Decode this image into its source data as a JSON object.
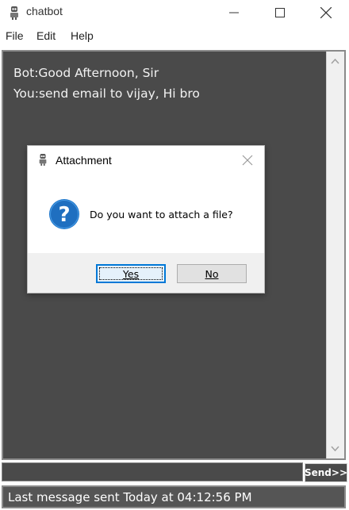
{
  "window": {
    "title": "chatbot",
    "icon": "robot-icon"
  },
  "menu": {
    "items": [
      "File",
      "Edit",
      "Help"
    ]
  },
  "chat": {
    "messages": [
      "Bot:Good Afternoon, Sir",
      "You:send email to vijay, Hi bro"
    ],
    "background": "#4a4a4a"
  },
  "input": {
    "value": "",
    "send_label": "Send>>"
  },
  "status": {
    "text": "Last message sent Today at 04:12:56 PM"
  },
  "dialog": {
    "title": "Attachment",
    "icon": "question-icon",
    "message": "Do you want to attach a file?",
    "yes_label": "Yes",
    "no_label": "No",
    "accent": "#0078d7"
  }
}
